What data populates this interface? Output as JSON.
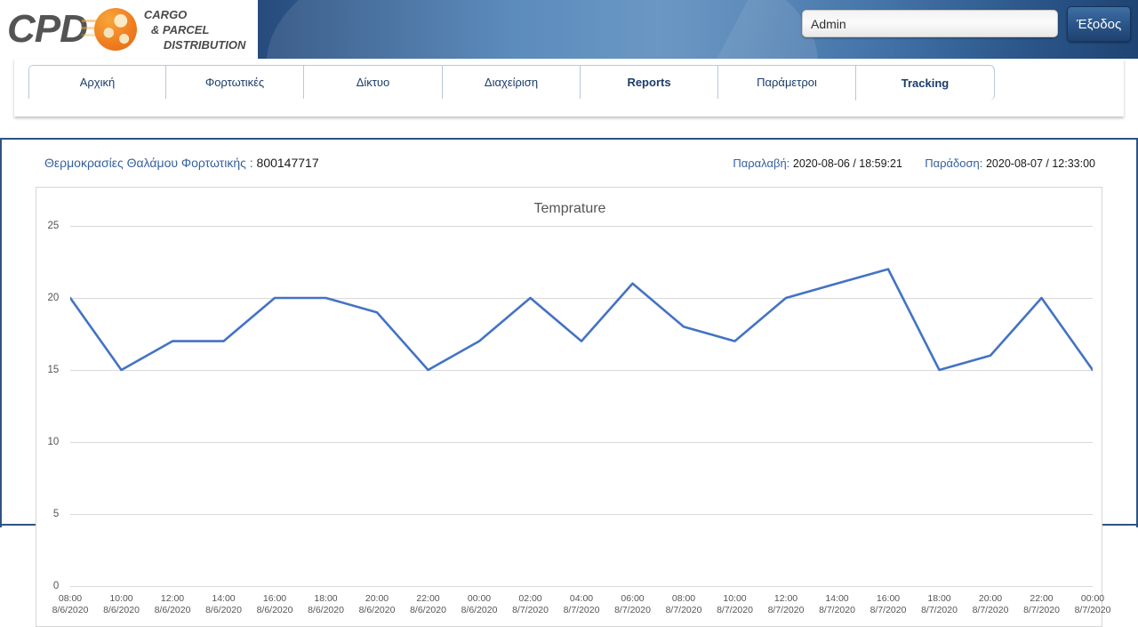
{
  "header": {
    "logo_main": "CPD",
    "logo_line1": "CARGO",
    "logo_line2": "& PARCEL",
    "logo_line3": "DISTRIBUTION",
    "user_value": "Admin",
    "user_placeholder": "Admin",
    "logout_label": "Έξοδος"
  },
  "nav": {
    "items": [
      {
        "label": "Αρχική",
        "width": 155,
        "bold": false
      },
      {
        "label": "Φορτωτικές",
        "width": 156,
        "bold": false
      },
      {
        "label": "Δίκτυο",
        "width": 157,
        "bold": false
      },
      {
        "label": "Διαχείριση",
        "width": 156,
        "bold": false
      },
      {
        "label": "Reports",
        "width": 156,
        "bold": true
      },
      {
        "label": "Παράμετροι",
        "width": 156,
        "bold": false
      },
      {
        "label": "Tracking",
        "width": 157,
        "bold": true
      }
    ]
  },
  "info": {
    "title_label": "Θερμοκρασίες Θαλάμου Φορτωτικής : ",
    "title_number": "800147717",
    "pickup_label": "Παραλαβή:",
    "pickup_value": "2020-08-06 / 18:59:21",
    "delivery_label": "Παράδοση:",
    "delivery_value": "2020-08-07 / 12:33:00"
  },
  "chart_data": {
    "type": "line",
    "title": "Temprature",
    "xlabel": "",
    "ylabel": "",
    "ylim": [
      0,
      25
    ],
    "yticks": [
      0,
      5,
      10,
      15,
      20,
      25
    ],
    "grid": true,
    "legend": false,
    "line_color": "#4373c4",
    "categories": [
      "08:00\n8/6/2020",
      "10:00\n8/6/2020",
      "12:00\n8/6/2020",
      "14:00\n8/6/2020",
      "16:00\n8/6/2020",
      "18:00\n8/6/2020",
      "20:00\n8/6/2020",
      "22:00\n8/6/2020",
      "00:00\n8/6/2020",
      "02:00\n8/7/2020",
      "04:00\n8/7/2020",
      "06:00\n8/7/2020",
      "08:00\n8/7/2020",
      "10:00\n8/7/2020",
      "12:00\n8/7/2020",
      "14:00\n8/7/2020",
      "16:00\n8/7/2020",
      "18:00\n8/7/2020",
      "20:00\n8/7/2020",
      "22:00\n8/7/2020",
      "00:00\n8/7/2020"
    ],
    "x_times": [
      "08:00",
      "10:00",
      "12:00",
      "14:00",
      "16:00",
      "18:00",
      "20:00",
      "22:00",
      "00:00",
      "02:00",
      "04:00",
      "06:00",
      "08:00",
      "10:00",
      "12:00",
      "14:00",
      "16:00",
      "18:00",
      "20:00",
      "22:00",
      "00:00"
    ],
    "x_dates": [
      "8/6/2020",
      "8/6/2020",
      "8/6/2020",
      "8/6/2020",
      "8/6/2020",
      "8/6/2020",
      "8/6/2020",
      "8/6/2020",
      "8/6/2020",
      "8/7/2020",
      "8/7/2020",
      "8/7/2020",
      "8/7/2020",
      "8/7/2020",
      "8/7/2020",
      "8/7/2020",
      "8/7/2020",
      "8/7/2020",
      "8/7/2020",
      "8/7/2020",
      "8/7/2020"
    ],
    "values": [
      20,
      15,
      17,
      17,
      20,
      20,
      19,
      15,
      17,
      20,
      17,
      21,
      18,
      17,
      20,
      21,
      22,
      15,
      16,
      20,
      15
    ]
  }
}
